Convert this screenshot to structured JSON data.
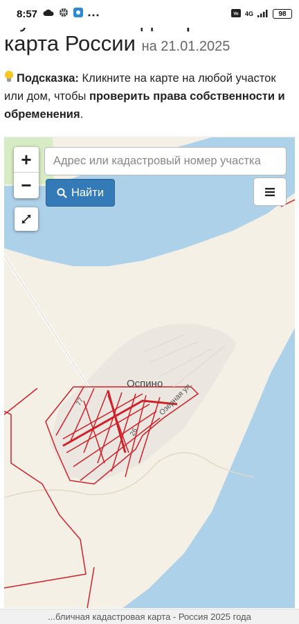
{
  "status_bar": {
    "time": "8:57",
    "network_type": "4G",
    "battery": "98",
    "icons": [
      "cloud-icon",
      "basketball-icon",
      "app-icon",
      "more-dots-icon",
      "volte-icon",
      "signal-icon",
      "battery-icon"
    ]
  },
  "header": {
    "title": "Публичная кадастровая карта России",
    "date": "на 21.01.2025"
  },
  "hint": {
    "icon": "lightbulb-icon",
    "label": "Подсказка:",
    "text_1": " Кликните на карте на любой участок или дом, чтобы ",
    "emphasis": "проверить права собственности и обременения",
    "text_2": "."
  },
  "map": {
    "zoom_in_label": "+",
    "zoom_out_label": "−",
    "search_placeholder": "Адрес или кадастровый номер участка",
    "search_value": "",
    "search_button_label": "Найти",
    "menu_label": "☰",
    "village_label": "Оспино",
    "street_label": "Озерная ул.",
    "parcel_label_1": "77",
    "parcel_label_2": "26",
    "colors": {
      "water": "#aed1ea",
      "land": "#f4f0e6",
      "settlement": "#ebe6df",
      "green": "#d7ecc4",
      "parcel_border": "#d0202a",
      "button": "#337ab7"
    }
  },
  "footer": {
    "caption": "...бличная кадастровая карта - Россия 2025 года"
  }
}
